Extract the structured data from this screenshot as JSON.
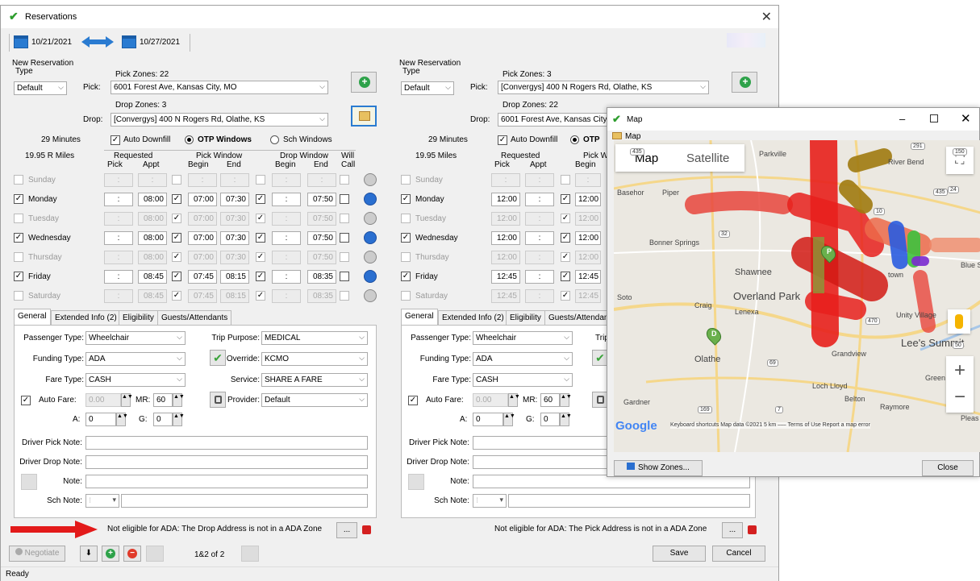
{
  "window": {
    "title": "Reservations"
  },
  "toolbar": {
    "date1": "10/21/2021",
    "date2": "10/27/2021"
  },
  "left": {
    "group_title": "New Reservation",
    "type_label": "Type",
    "type_value": "Default",
    "pick_zones": "Pick Zones: 22",
    "pick_label": "Pick:",
    "pick_value": "6001 Forest Ave, Kansas City, MO",
    "drop_zones": "Drop Zones: 3",
    "drop_label": "Drop:",
    "drop_value": "[Convergys] 400 N Rogers Rd, Olathe, KS",
    "minutes": "29 Minutes",
    "miles": "19.95 R Miles",
    "auto_downfill": "Auto Downfill",
    "otp_windows": "OTP Windows",
    "sch_windows": "Sch Windows",
    "hdr_requested": "Requested",
    "hdr_pick": "Pick",
    "hdr_appt": "Appt",
    "hdr_pick_window": "Pick Window",
    "hdr_begin": "Begin",
    "hdr_end": "End",
    "hdr_drop_window": "Drop Window",
    "hdr_begin2": "Begin",
    "hdr_end2": "End",
    "hdr_will": "Will",
    "hdr_call": "Call",
    "days": [
      {
        "name": "Sunday",
        "on": false,
        "pick": ":",
        "appt": ":",
        "pb": ":",
        "pe": ":",
        "db": ":",
        "de": ":",
        "active": false
      },
      {
        "name": "Monday",
        "on": true,
        "pick": ":",
        "appt": "08:00",
        "pb": "07:00",
        "pe": "07:30",
        "db": ":",
        "de": "07:50",
        "active": true
      },
      {
        "name": "Tuesday",
        "on": false,
        "pick": ":",
        "appt": "08:00",
        "pb": "07:00",
        "pe": "07:30",
        "db": ":",
        "de": "07:50",
        "active": false
      },
      {
        "name": "Wednesday",
        "on": true,
        "pick": ":",
        "appt": "08:00",
        "pb": "07:00",
        "pe": "07:30",
        "db": ":",
        "de": "07:50",
        "active": true
      },
      {
        "name": "Thursday",
        "on": false,
        "pick": ":",
        "appt": "08:00",
        "pb": "07:00",
        "pe": "07:30",
        "db": ":",
        "de": "07:50",
        "active": false
      },
      {
        "name": "Friday",
        "on": true,
        "pick": ":",
        "appt": "08:45",
        "pb": "07:45",
        "pe": "08:15",
        "db": ":",
        "de": "08:35",
        "active": true
      },
      {
        "name": "Saturday",
        "on": false,
        "pick": ":",
        "appt": "08:45",
        "pb": "07:45",
        "pe": "08:15",
        "db": ":",
        "de": "08:35",
        "active": false
      }
    ],
    "tabs": [
      "General",
      "Extended Info (2)",
      "Eligibility",
      "Guests/Attendants"
    ],
    "passenger_type_label": "Passenger Type:",
    "passenger_type": "Wheelchair",
    "funding_type_label": "Funding Type:",
    "funding_type": "ADA",
    "fare_type_label": "Fare Type:",
    "fare_type": "CASH",
    "auto_fare_label": "Auto Fare:",
    "auto_fare": "0.00",
    "mr_label": "MR:",
    "mr": "60",
    "a_label": "A:",
    "a": "0",
    "g_label": "G:",
    "g": "0",
    "trip_purpose_label": "Trip Purpose:",
    "trip_purpose": "MEDICAL",
    "override_label": "Override:",
    "override": "KCMO",
    "service_label": "Service:",
    "service": "SHARE A FARE",
    "provider_label": "Provider:",
    "provider": "Default",
    "driver_pick_label": "Driver Pick Note:",
    "driver_drop_label": "Driver Drop Note:",
    "note_label": "Note:",
    "sch_note_label": "Sch Note:",
    "eligibility_msg": "Not eligible for ADA: The Drop Address is not in a ADA Zone",
    "dots": "..."
  },
  "right": {
    "group_title": "New Reservation",
    "type_label": "Type",
    "type_value": "Default",
    "pick_zones": "Pick Zones: 3",
    "pick_label": "Pick:",
    "pick_value": "[Convergys] 400 N Rogers Rd, Olathe, KS",
    "drop_zones": "Drop Zones: 22",
    "drop_label": "Drop:",
    "drop_value": "6001 Forest Ave, Kansas City",
    "minutes": "29 Minutes",
    "miles": "19.95 Miles",
    "auto_downfill": "Auto Downfill",
    "otp": "OTP",
    "hdr_requested": "Requested",
    "hdr_pick": "Pick",
    "hdr_appt": "Appt",
    "hdr_pick_window": "Pick W",
    "hdr_begin": "Begin",
    "days": [
      {
        "name": "Sunday",
        "on": false,
        "pick": ":",
        "appt": ":",
        "pb": ":",
        "active": false
      },
      {
        "name": "Monday",
        "on": true,
        "pick": "12:00",
        "appt": ":",
        "pb": "12:00",
        "active": true
      },
      {
        "name": "Tuesday",
        "on": false,
        "pick": "12:00",
        "appt": ":",
        "pb": "12:00",
        "active": false
      },
      {
        "name": "Wednesday",
        "on": true,
        "pick": "12:00",
        "appt": ":",
        "pb": "12:00",
        "active": true
      },
      {
        "name": "Thursday",
        "on": false,
        "pick": "12:00",
        "appt": ":",
        "pb": "12:00",
        "active": false
      },
      {
        "name": "Friday",
        "on": true,
        "pick": "12:45",
        "appt": ":",
        "pb": "12:45",
        "active": true
      },
      {
        "name": "Saturday",
        "on": false,
        "pick": "12:45",
        "appt": ":",
        "pb": "12:45",
        "active": false
      }
    ],
    "tabs": [
      "General",
      "Extended Info (2)",
      "Eligibility",
      "Guests/Attendan"
    ],
    "passenger_type_label": "Passenger Type:",
    "passenger_type": "Wheelchair",
    "funding_type_label": "Funding Type:",
    "funding_type": "ADA",
    "fare_type_label": "Fare Type:",
    "fare_type": "CASH",
    "auto_fare_label": "Auto Fare:",
    "auto_fare": "0.00",
    "mr_label": "MR:",
    "mr": "60",
    "a_label": "A:",
    "a": "0",
    "g_label": "G:",
    "g": "0",
    "trip_label": "Trip",
    "driver_pick_label": "Driver Pick Note:",
    "driver_drop_label": "Driver Drop Note:",
    "note_label": "Note:",
    "sch_note_label": "Sch Note:",
    "eligibility_msg": "Not eligible for ADA: The Pick Address is not in a ADA Zone",
    "dots": "..."
  },
  "bottom": {
    "negotiate": "Negotiate",
    "pager": "1&2 of 2",
    "save": "Save",
    "cancel": "Cancel",
    "status": "Ready"
  },
  "map": {
    "title": "Map",
    "subtitle": "Map",
    "tab_map": "Map",
    "tab_satellite": "Satellite",
    "places": [
      "Parkville",
      "River Bend",
      "Basehor",
      "Piper",
      "Bonner Springs",
      "Shawnee",
      "Overland Park",
      "Soto",
      "Craig",
      "Lenexa",
      "Unity Village",
      "Lee's Summit",
      "Olathe",
      "Grandview",
      "Loch Lloyd",
      "Belton",
      "Gardner",
      "Raymore",
      "Green",
      "Blue Sp",
      "Pleas",
      "town"
    ],
    "highways": [
      "291",
      "435",
      "24",
      "32",
      "10",
      "470",
      "50",
      "69",
      "169",
      "7",
      "435",
      "150"
    ],
    "pins": [
      "P",
      "D"
    ],
    "google": "Google",
    "attribution": "Keyboard shortcuts   Map data ©2021   5 km ⎯⎯⎯   Terms of Use   Report a map error",
    "show_zones": "Show Zones...",
    "close": "Close"
  }
}
